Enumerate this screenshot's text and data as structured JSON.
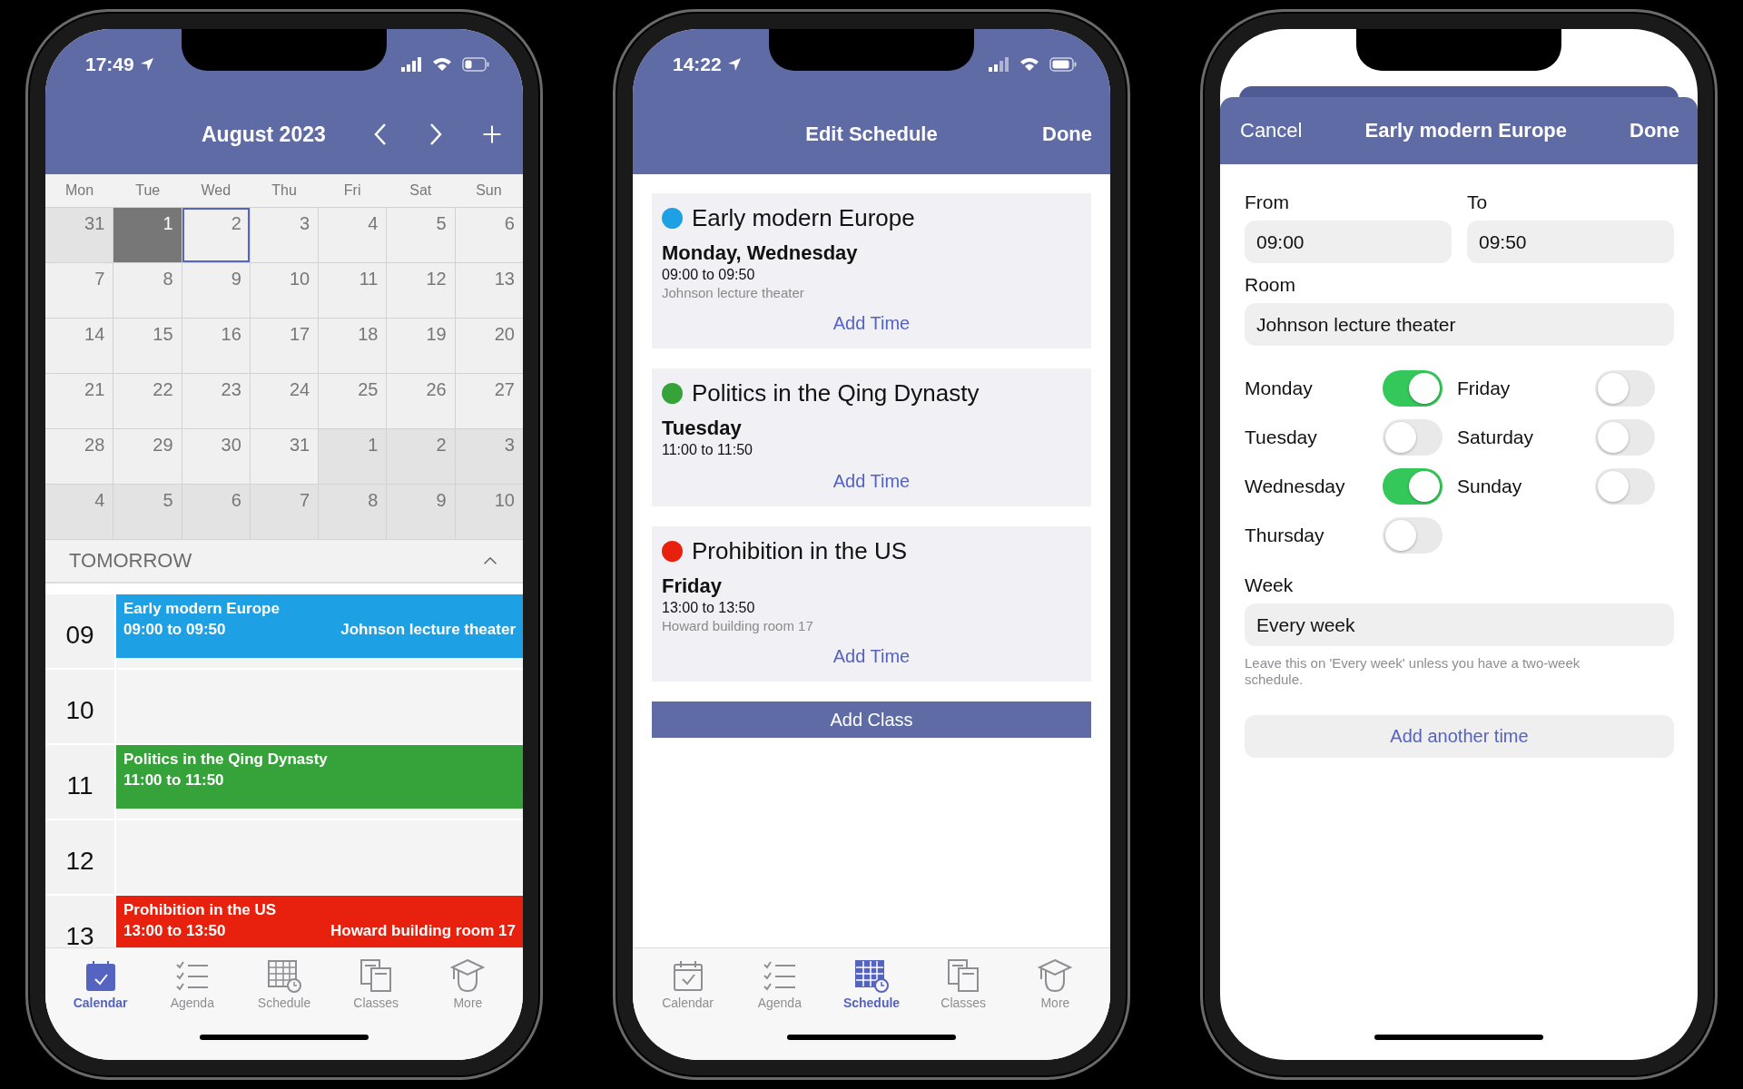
{
  "calendar_screen": {
    "status_bar": {
      "time": "17:49"
    },
    "header": {
      "title": "August 2023"
    },
    "weekdays": [
      "Mon",
      "Tue",
      "Wed",
      "Thu",
      "Fri",
      "Sat",
      "Sun"
    ],
    "days": [
      {
        "label": "31",
        "kind": "other"
      },
      {
        "label": "1",
        "kind": "today"
      },
      {
        "label": "2",
        "kind": "selected"
      },
      {
        "label": "3",
        "kind": "day"
      },
      {
        "label": "4",
        "kind": "day"
      },
      {
        "label": "5",
        "kind": "day"
      },
      {
        "label": "6",
        "kind": "day"
      },
      {
        "label": "7",
        "kind": "day"
      },
      {
        "label": "8",
        "kind": "day"
      },
      {
        "label": "9",
        "kind": "day"
      },
      {
        "label": "10",
        "kind": "day"
      },
      {
        "label": "11",
        "kind": "day"
      },
      {
        "label": "12",
        "kind": "day"
      },
      {
        "label": "13",
        "kind": "day"
      },
      {
        "label": "14",
        "kind": "day"
      },
      {
        "label": "15",
        "kind": "day"
      },
      {
        "label": "16",
        "kind": "day"
      },
      {
        "label": "17",
        "kind": "day"
      },
      {
        "label": "18",
        "kind": "day"
      },
      {
        "label": "19",
        "kind": "day"
      },
      {
        "label": "20",
        "kind": "day"
      },
      {
        "label": "21",
        "kind": "day"
      },
      {
        "label": "22",
        "kind": "day"
      },
      {
        "label": "23",
        "kind": "day"
      },
      {
        "label": "24",
        "kind": "day"
      },
      {
        "label": "25",
        "kind": "day"
      },
      {
        "label": "26",
        "kind": "day"
      },
      {
        "label": "27",
        "kind": "day"
      },
      {
        "label": "28",
        "kind": "day"
      },
      {
        "label": "29",
        "kind": "day"
      },
      {
        "label": "30",
        "kind": "day"
      },
      {
        "label": "31",
        "kind": "day"
      },
      {
        "label": "1",
        "kind": "other"
      },
      {
        "label": "2",
        "kind": "other"
      },
      {
        "label": "3",
        "kind": "other"
      },
      {
        "label": "4",
        "kind": "other"
      },
      {
        "label": "5",
        "kind": "other"
      },
      {
        "label": "6",
        "kind": "other"
      },
      {
        "label": "7",
        "kind": "other"
      },
      {
        "label": "8",
        "kind": "other"
      },
      {
        "label": "9",
        "kind": "other"
      },
      {
        "label": "10",
        "kind": "other"
      }
    ],
    "agenda": {
      "heading": "TOMORROW",
      "expanded": true,
      "hours": [
        {
          "hour": "09",
          "event": {
            "title": "Early modern Europe",
            "time": "09:00 to 09:50",
            "room": "Johnson lecture theater",
            "color": "#1ea1e4"
          }
        },
        {
          "hour": "10"
        },
        {
          "hour": "11",
          "event": {
            "title": "Politics in the Qing Dynasty",
            "time": "11:00 to 11:50",
            "color": "#35a23a"
          }
        },
        {
          "hour": "12"
        },
        {
          "hour": "13",
          "event": {
            "title": "Prohibition in the US",
            "time": "13:00 to 13:50",
            "room": "Howard building room 17",
            "color": "#e8200e"
          }
        }
      ]
    },
    "tabs": [
      {
        "label": "Calendar",
        "selected": true
      },
      {
        "label": "Agenda",
        "selected": false
      },
      {
        "label": "Schedule",
        "selected": false
      },
      {
        "label": "Classes",
        "selected": false
      },
      {
        "label": "More",
        "selected": false
      }
    ]
  },
  "schedule_screen": {
    "status_bar": {
      "time": "14:22"
    },
    "header": {
      "title": "Edit Schedule",
      "done": "Done"
    },
    "classes": [
      {
        "title": "Early modern Europe",
        "color": "#1ea1e4",
        "days": "Monday, Wednesday",
        "time": "09:00 to 09:50",
        "room": "Johnson lecture theater",
        "action": "Add Time"
      },
      {
        "title": "Politics in the Qing Dynasty",
        "color": "#35a23a",
        "days": "Tuesday",
        "time": "11:00 to 11:50",
        "action": "Add Time"
      },
      {
        "title": "Prohibition in the US",
        "color": "#e8200e",
        "days": "Friday",
        "time": "13:00 to 13:50",
        "room": "Howard building room 17",
        "action": "Add Time"
      }
    ],
    "add_class": "Add Class",
    "tabs": [
      {
        "label": "Calendar",
        "selected": false
      },
      {
        "label": "Agenda",
        "selected": false
      },
      {
        "label": "Schedule",
        "selected": true
      },
      {
        "label": "Classes",
        "selected": false
      },
      {
        "label": "More",
        "selected": false
      }
    ]
  },
  "edit_time_screen": {
    "header": {
      "cancel": "Cancel",
      "title": "Early modern Europe",
      "done": "Done"
    },
    "from": {
      "label": "From",
      "value": "09:00"
    },
    "to": {
      "label": "To",
      "value": "09:50"
    },
    "room": {
      "label": "Room",
      "value": "Johnson lecture theater"
    },
    "days": [
      {
        "label": "Monday",
        "on": true
      },
      {
        "label": "Tuesday",
        "on": false
      },
      {
        "label": "Wednesday",
        "on": true
      },
      {
        "label": "Thursday",
        "on": false
      },
      {
        "label": "Friday",
        "on": false
      },
      {
        "label": "Saturday",
        "on": false
      },
      {
        "label": "Sunday",
        "on": false
      }
    ],
    "week": {
      "label": "Week",
      "value": "Every week",
      "hint": "Leave this on 'Every week' unless you have a two-week schedule."
    },
    "add_time": "Add another time"
  }
}
